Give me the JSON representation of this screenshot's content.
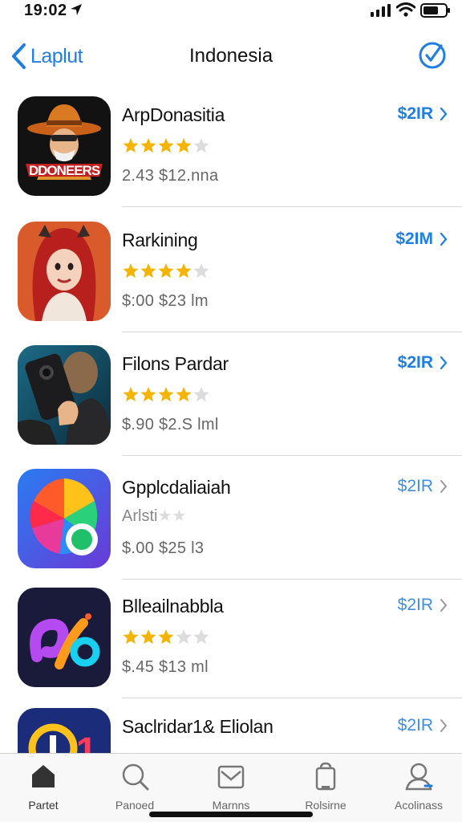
{
  "status_bar": {
    "time": "19:02",
    "icons": [
      "location-arrow-icon",
      "signal-icon",
      "wifi-icon",
      "battery-icon"
    ]
  },
  "nav": {
    "back_label": "Laplut",
    "title": "Indonesia",
    "right_icon": "check-circle-icon"
  },
  "colors": {
    "accent": "#1e7fe0",
    "star": "#f5b400",
    "star_empty": "#dcdcdc",
    "divider": "#d8d8d8"
  },
  "apps": [
    {
      "name": "ArpDonasitia",
      "rating_stars": 4,
      "rating_text": "",
      "price_line": "2.43  $12.nna",
      "get_label": "$2IR",
      "icon": "cowboy-app-icon"
    },
    {
      "name": "Rarkining",
      "rating_stars": 4,
      "rating_text": "",
      "price_line": "$:00  $23 lm",
      "get_label": "$2IM",
      "icon": "redhood-app-icon"
    },
    {
      "name": "Filons Pardar",
      "rating_stars": 4,
      "rating_text": "",
      "price_line": "$.90  $2.S lml",
      "get_label": "$2IR",
      "icon": "phone-camera-app-icon"
    },
    {
      "name": "Gpplcdaliaiah",
      "rating_stars": 0,
      "rating_text": "Arlsti",
      "price_line": "$.00  $25 l3",
      "get_label": "$2IR",
      "icon": "color-wheel-app-icon"
    },
    {
      "name": "Blleailnabbla",
      "rating_stars": 3,
      "rating_text": "",
      "price_line": "$.45  $13 ml",
      "get_label": "$2IR",
      "icon": "swirl-app-icon"
    },
    {
      "name": "Saclridar1& Eliolan",
      "rating_stars": 0,
      "rating_text": "",
      "price_line": "",
      "get_label": "$2IR",
      "icon": "number-app-icon"
    }
  ],
  "tabs": [
    {
      "label": "Partet",
      "icon": "home-icon",
      "active": true
    },
    {
      "label": "Panoed",
      "icon": "search-icon",
      "active": false
    },
    {
      "label": "Marnns",
      "icon": "mail-icon",
      "active": false
    },
    {
      "label": "Rolsirne",
      "icon": "bag-icon",
      "active": false
    },
    {
      "label": "Acolinass",
      "icon": "person-icon",
      "active": false
    }
  ]
}
